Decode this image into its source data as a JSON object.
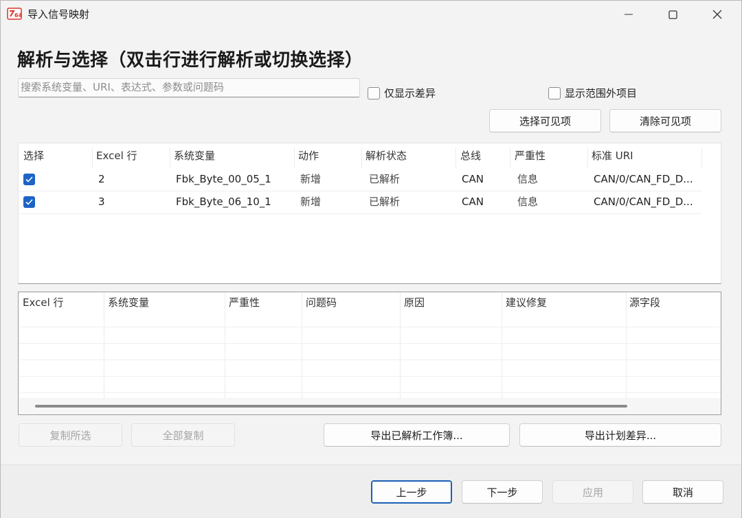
{
  "window": {
    "title": "导入信号映射",
    "controls": {
      "minimize": "minimize-icon",
      "maximize": "maximize-icon",
      "close": "close-icon"
    }
  },
  "page_title": "解析与选择（双击行进行解析或切换选择）",
  "search": {
    "value": "",
    "placeholder": "搜索系统变量、URI、表达式、参数或问题码"
  },
  "filters": {
    "only_diff": {
      "label": "仅显示差异",
      "checked": false
    },
    "show_out_of_range": {
      "label": "显示范围外项目",
      "checked": false
    }
  },
  "visible_actions": {
    "select_visible": "选择可见项",
    "clear_visible": "清除可见项"
  },
  "main_table": {
    "columns": [
      "选择",
      "Excel 行",
      "系统变量",
      "动作",
      "解析状态",
      "总线",
      "严重性",
      "标准 URI"
    ],
    "rows": [
      {
        "selected": true,
        "excel_row": "2",
        "system_variable": "Fbk_Byte_00_05_1",
        "action": "新增",
        "status": "已解析",
        "bus": "CAN",
        "severity": "信息",
        "uri": "CAN/0/CAN_FD_D..."
      },
      {
        "selected": true,
        "excel_row": "3",
        "system_variable": "Fbk_Byte_06_10_1",
        "action": "新增",
        "status": "已解析",
        "bus": "CAN",
        "severity": "信息",
        "uri": "CAN/0/CAN_FD_D..."
      }
    ]
  },
  "issues_table": {
    "columns": [
      "Excel 行",
      "系统变量",
      "严重性",
      "问题码",
      "原因",
      "建议修复",
      "源字段"
    ]
  },
  "copy_actions": {
    "copy_selected": "复制所选",
    "copy_all": "全部复制"
  },
  "export_actions": {
    "export_workbook": "导出已解析工作簿...",
    "export_plan_diff": "导出计划差异..."
  },
  "footer": {
    "prev": "上一步",
    "next": "下一步",
    "apply": "应用",
    "cancel": "取消"
  },
  "colors": {
    "accent": "#1e63c8",
    "primary_border": "#1a5fb4",
    "disabled_text": "#a4a4a4"
  }
}
